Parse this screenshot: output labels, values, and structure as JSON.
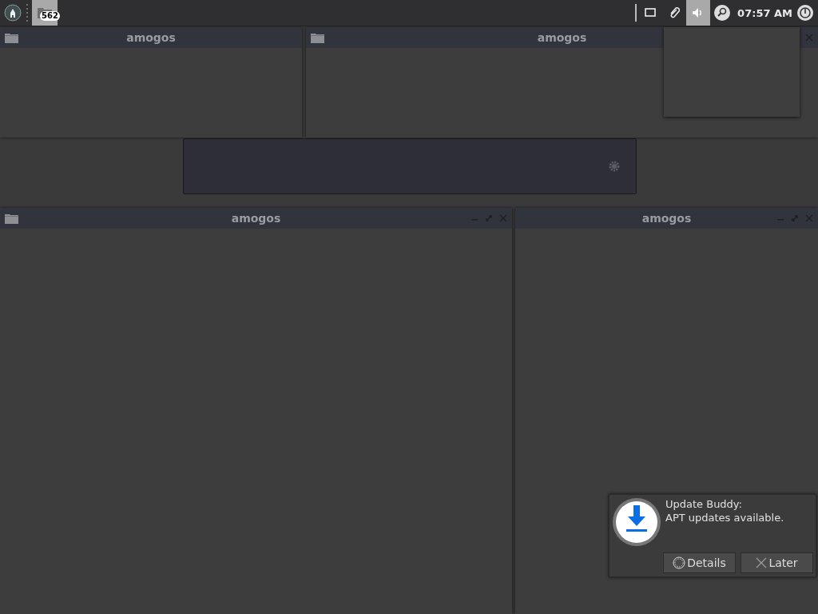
{
  "taskbar": {
    "tasks": [
      {
        "badge": "562",
        "selected": true
      }
    ],
    "tray": [
      {
        "kind": "display",
        "selected": false
      },
      {
        "kind": "clip",
        "selected": false
      },
      {
        "kind": "volume",
        "selected": true
      },
      {
        "kind": "search",
        "selected": false
      }
    ],
    "clock": "07:57 AM"
  },
  "windows": [
    {
      "title": "amogos",
      "folder_icon": true,
      "controls": false
    },
    {
      "title": "amogos",
      "folder_icon": true,
      "controls": true
    },
    {
      "title": "amogos",
      "folder_icon": true,
      "controls": true
    },
    {
      "title": "amogos",
      "folder_icon": false,
      "controls": true
    }
  ],
  "notification": {
    "title": "Update Buddy:",
    "message": "APT updates available.",
    "actions": [
      {
        "label": "Details",
        "kind": "details"
      },
      {
        "label": "Later",
        "kind": "dismiss"
      }
    ]
  }
}
